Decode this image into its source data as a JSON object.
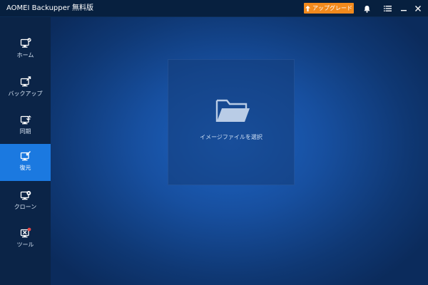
{
  "window": {
    "title": "AOMEI Backupper 無料版"
  },
  "titlebar": {
    "upgrade_label": "アップグレード",
    "icons": [
      "bell-icon",
      "menu-icon",
      "minimize-icon",
      "close-icon"
    ]
  },
  "sidebar": {
    "items": [
      {
        "label": "ホーム",
        "icon": "home-icon",
        "active": false
      },
      {
        "label": "バックアップ",
        "icon": "backup-icon",
        "active": false
      },
      {
        "label": "同期",
        "icon": "sync-icon",
        "active": false
      },
      {
        "label": "復元",
        "icon": "restore-icon",
        "active": true
      },
      {
        "label": "クローン",
        "icon": "clone-icon",
        "active": false
      },
      {
        "label": "ツール",
        "icon": "tools-icon",
        "active": false
      }
    ]
  },
  "main": {
    "select_image_label": "イメージファイルを選択"
  },
  "colors": {
    "titlebar_bg": "#07203f",
    "sidebar_bg": "#0b2447",
    "active_bg": "#1b79e0",
    "upgrade_bg": "#f28a1d",
    "main_center": "#1d64c4",
    "main_edge": "#0b2b5c",
    "tools_badge": "#e84646"
  }
}
